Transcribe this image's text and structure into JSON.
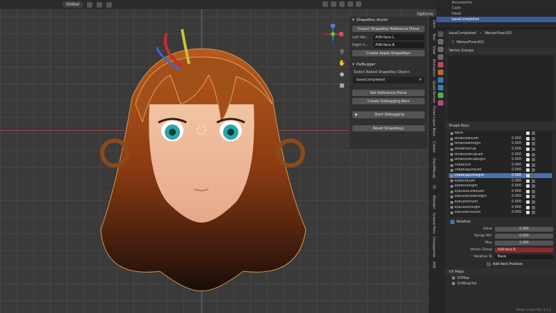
{
  "viewport": {
    "orientation_label": "Global",
    "options_label": "Options"
  },
  "npanel": {
    "shapekey_assist": {
      "title": "ShapeKey Assist",
      "import_button": "Import ShapeKey Reference Plane",
      "left_label": "Left Ver...",
      "left_value": "ASK-face.L",
      "right_label": "Right V...",
      "right_value": "ASK-face.R",
      "create_button": "Create Apple ShapeKeys"
    },
    "debugger": {
      "title": "DeBugger",
      "select_label": "Select Baked ShapeKey Object:",
      "object_value": "baseCompleted",
      "set_ref_button": "Set Reference Plane",
      "create_bars_button": "Create Debugging Bars",
      "start_button": "Start Debugging",
      "reset_button": "Reset ShapeKeys"
    }
  },
  "vtabs": [
    "Item",
    "Tool",
    "View",
    "Animation",
    "Quad Remesh",
    "Three Layer Booster",
    "Create",
    "iFaceMocap",
    "ID",
    "Blender",
    "Grease Pencil",
    "Unsupported",
    "ASK"
  ],
  "outliner": {
    "rows": [
      "Accessories",
      "Cloth",
      "Head",
      "baseCompleted",
      ""
    ]
  },
  "properties": {
    "breadcrumb_object": "baseCompleted",
    "breadcrumb_mesh": "WeirpoFlow.002",
    "mesh_name": "WeirpoFlow.002",
    "vertex_groups_title": "Vertex Groups",
    "shape_keys_title": "Shape Keys",
    "shape_keys": [
      {
        "name": "Basis",
        "value": ""
      },
      {
        "name": "browDownLeft",
        "value": "0.000"
      },
      {
        "name": "browDownRight",
        "value": "0.000"
      },
      {
        "name": "browInnerUp",
        "value": "0.000"
      },
      {
        "name": "browOuterUpLeft",
        "value": "0.000"
      },
      {
        "name": "browOuterUpRight",
        "value": "0.000"
      },
      {
        "name": "cheekPuff",
        "value": "0.000"
      },
      {
        "name": "cheekSquintLeft",
        "value": "0.000"
      },
      {
        "name": "cheekSquintRight",
        "value": "0.000"
      },
      {
        "name": "eyeBlinkLeft",
        "value": "0.000"
      },
      {
        "name": "eyeBlinkRight",
        "value": "0.000"
      },
      {
        "name": "eyeLookDownLeft",
        "value": "0.000"
      },
      {
        "name": "eyeLookDownRight",
        "value": "0.000"
      },
      {
        "name": "eyeLookInLeft",
        "value": "0.000"
      },
      {
        "name": "eyeLookInRight",
        "value": "0.000"
      },
      {
        "name": "eyeLookOutLeft",
        "value": "0.000"
      }
    ],
    "selected_shape_key": "cheekSquintRight",
    "relative_label": "Relative",
    "value_label": "Value",
    "value": "0.000",
    "range_min_label": "Range Min",
    "range_min": "0.000",
    "max_label": "Max",
    "max": "1.000",
    "vertex_group_label": "Vertex Group",
    "vertex_group_value": "ASK-face.R",
    "relative_to_label": "Relative To",
    "relative_to_value": "Basis",
    "add_rest_label": "Add Rest Position",
    "uv_maps_title": "UV Maps",
    "uv_maps": [
      "UVMap",
      "UVWrapTxt"
    ],
    "status": "VRAM: 5.1/8.0 GB | 4.3.2"
  }
}
